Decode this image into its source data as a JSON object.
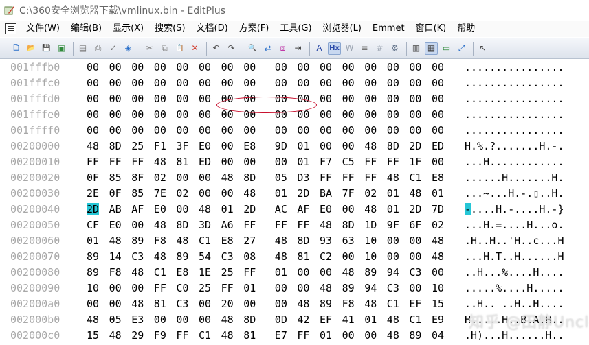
{
  "window": {
    "title": "C:\\360安全浏览器下载\\vmlinux.bin - EditPlus"
  },
  "menu": [
    "文件(W)",
    "编辑(B)",
    "显示(X)",
    "搜索(S)",
    "文档(D)",
    "方案(F)",
    "工具(G)",
    "浏览器(L)",
    "Emmet",
    "窗口(K)",
    "帮助"
  ],
  "toolbar": {
    "buttons": [
      {
        "name": "new-icon",
        "glyph": "🗋",
        "color": "#2a6fc9"
      },
      {
        "name": "open-icon",
        "glyph": "📂",
        "color": "#c99a2a"
      },
      {
        "name": "save-icon",
        "glyph": "💾",
        "color": "#3a6aa8"
      },
      {
        "name": "save-all-icon",
        "glyph": "▣",
        "color": "#2f8a3a"
      },
      {
        "sep": true
      },
      {
        "name": "print-preview-icon",
        "glyph": "▤",
        "color": "#777"
      },
      {
        "name": "print-icon",
        "glyph": "⎙",
        "color": "#777"
      },
      {
        "name": "spell-check-icon",
        "glyph": "✓",
        "color": "#6a6a6a"
      },
      {
        "name": "browser-preview-icon",
        "glyph": "◈",
        "color": "#2a6fc9"
      },
      {
        "sep": true
      },
      {
        "name": "cut-icon",
        "glyph": "✂",
        "color": "#888"
      },
      {
        "name": "copy-icon",
        "glyph": "⧉",
        "color": "#888"
      },
      {
        "name": "paste-icon",
        "glyph": "📋",
        "color": "#888"
      },
      {
        "name": "delete-icon",
        "glyph": "✕",
        "color": "#d23a2a"
      },
      {
        "sep": true
      },
      {
        "name": "undo-icon",
        "glyph": "↶",
        "color": "#555"
      },
      {
        "name": "redo-icon",
        "glyph": "↷",
        "color": "#555"
      },
      {
        "sep": true
      },
      {
        "name": "find-icon",
        "glyph": "🔍",
        "color": "#444"
      },
      {
        "name": "replace-icon",
        "glyph": "⇄",
        "color": "#2a6fc9"
      },
      {
        "name": "find-in-files-icon",
        "glyph": "⧈",
        "color": "#c03aa8"
      },
      {
        "name": "goto-icon",
        "glyph": "⇥",
        "color": "#444"
      },
      {
        "sep": true
      },
      {
        "name": "font-icon",
        "glyph": "A",
        "color": "#2a4aa8"
      },
      {
        "name": "hex-view-icon",
        "glyph": "Hx",
        "color": "#2a4aa8",
        "active": true
      },
      {
        "name": "word-wrap-icon",
        "glyph": "W",
        "color": "#9aa3b0"
      },
      {
        "name": "ruler-icon",
        "glyph": "≡",
        "color": "#777"
      },
      {
        "name": "line-numbers-icon",
        "glyph": "#",
        "color": "#9aa3b0"
      },
      {
        "name": "settings-icon",
        "glyph": "⚙",
        "color": "#6a7a90"
      },
      {
        "sep": true
      },
      {
        "name": "directory-window-icon",
        "glyph": "▥",
        "color": "#444"
      },
      {
        "name": "cliptext-window-icon",
        "glyph": "▦",
        "color": "#444",
        "active": true
      },
      {
        "name": "output-window-icon",
        "glyph": "▭",
        "color": "#2f8a3a"
      },
      {
        "name": "fullscreen-icon",
        "glyph": "⤢",
        "color": "#2a6fc9"
      },
      {
        "sep": true
      },
      {
        "name": "pointer-icon",
        "glyph": "↖",
        "color": "#444"
      }
    ]
  },
  "hex": {
    "rows": [
      {
        "addr": "001fffb0",
        "bytes": [
          "00",
          "00",
          "00",
          "00",
          "00",
          "00",
          "00",
          "00",
          "00",
          "00",
          "00",
          "00",
          "00",
          "00",
          "00",
          "00"
        ],
        "ascii": "................"
      },
      {
        "addr": "001fffc0",
        "bytes": [
          "00",
          "00",
          "00",
          "00",
          "00",
          "00",
          "00",
          "00",
          "00",
          "00",
          "00",
          "00",
          "00",
          "00",
          "00",
          "00"
        ],
        "ascii": "................"
      },
      {
        "addr": "001fffd0",
        "bytes": [
          "00",
          "00",
          "00",
          "00",
          "00",
          "00",
          "00",
          "00",
          "00",
          "00",
          "00",
          "00",
          "00",
          "00",
          "00",
          "00"
        ],
        "ascii": "................"
      },
      {
        "addr": "001fffe0",
        "bytes": [
          "00",
          "00",
          "00",
          "00",
          "00",
          "00",
          "00",
          "00",
          "00",
          "00",
          "00",
          "00",
          "00",
          "00",
          "00",
          "00"
        ],
        "ascii": "................"
      },
      {
        "addr": "001ffff0",
        "bytes": [
          "00",
          "00",
          "00",
          "00",
          "00",
          "00",
          "00",
          "00",
          "00",
          "00",
          "00",
          "00",
          "00",
          "00",
          "00",
          "00"
        ],
        "ascii": "................"
      },
      {
        "addr": "00200000",
        "bytes": [
          "48",
          "8D",
          "25",
          "F1",
          "3F",
          "E0",
          "00",
          "E8",
          "9D",
          "01",
          "00",
          "00",
          "48",
          "8D",
          "2D",
          "ED"
        ],
        "ascii": "H.%.?.......H.-."
      },
      {
        "addr": "00200010",
        "bytes": [
          "FF",
          "FF",
          "FF",
          "48",
          "81",
          "ED",
          "00",
          "00",
          "00",
          "01",
          "F7",
          "C5",
          "FF",
          "FF",
          "1F",
          "00"
        ],
        "ascii": "...H............"
      },
      {
        "addr": "00200020",
        "bytes": [
          "0F",
          "85",
          "8F",
          "02",
          "00",
          "00",
          "48",
          "8D",
          "05",
          "D3",
          "FF",
          "FF",
          "FF",
          "48",
          "C1",
          "E8"
        ],
        "ascii": "......H.......H."
      },
      {
        "addr": "00200030",
        "bytes": [
          "2E",
          "0F",
          "85",
          "7E",
          "02",
          "00",
          "00",
          "48",
          "01",
          "2D",
          "BA",
          "7F",
          "02",
          "01",
          "48",
          "01"
        ],
        "ascii": "...~...H.-.▯..H."
      },
      {
        "addr": "00200040",
        "bytes": [
          "2D",
          "AB",
          "AF",
          "E0",
          "00",
          "48",
          "01",
          "2D",
          "AC",
          "AF",
          "E0",
          "00",
          "48",
          "01",
          "2D",
          "7D"
        ],
        "ascii": "-....H.-....H.-}"
      },
      {
        "addr": "00200050",
        "bytes": [
          "CF",
          "E0",
          "00",
          "48",
          "8D",
          "3D",
          "A6",
          "FF",
          "FF",
          "FF",
          "48",
          "8D",
          "1D",
          "9F",
          "6F",
          "02"
        ],
        "ascii": "...H.=....H...o."
      },
      {
        "addr": "00200060",
        "bytes": [
          "01",
          "48",
          "89",
          "F8",
          "48",
          "C1",
          "E8",
          "27",
          "48",
          "8D",
          "93",
          "63",
          "10",
          "00",
          "00",
          "48"
        ],
        "ascii": ".H..H..'H..c...H"
      },
      {
        "addr": "00200070",
        "bytes": [
          "89",
          "14",
          "C3",
          "48",
          "89",
          "54",
          "C3",
          "08",
          "48",
          "81",
          "C2",
          "00",
          "10",
          "00",
          "00",
          "48"
        ],
        "ascii": "...H.T..H......H"
      },
      {
        "addr": "00200080",
        "bytes": [
          "89",
          "F8",
          "48",
          "C1",
          "E8",
          "1E",
          "25",
          "FF",
          "01",
          "00",
          "00",
          "48",
          "89",
          "94",
          "C3",
          "00"
        ],
        "ascii": "..H...%....H...."
      },
      {
        "addr": "00200090",
        "bytes": [
          "10",
          "00",
          "00",
          "FF",
          "C0",
          "25",
          "FF",
          "01",
          "00",
          "00",
          "48",
          "89",
          "94",
          "C3",
          "00",
          "10"
        ],
        "ascii": ".....%....H....."
      },
      {
        "addr": "002000a0",
        "bytes": [
          "00",
          "00",
          "48",
          "81",
          "C3",
          "00",
          "20",
          "00",
          "00",
          "48",
          "89",
          "F8",
          "48",
          "C1",
          "EF",
          "15"
        ],
        "ascii": "..H.. ..H..H...."
      },
      {
        "addr": "002000b0",
        "bytes": [
          "48",
          "05",
          "E3",
          "00",
          "00",
          "00",
          "48",
          "8D",
          "0D",
          "42",
          "EF",
          "41",
          "01",
          "48",
          "C1",
          "E9"
        ],
        "ascii": "H.....H..B.A.H.."
      },
      {
        "addr": "002000c0",
        "bytes": [
          "15",
          "48",
          "29",
          "F9",
          "FF",
          "C1",
          "48",
          "81",
          "E7",
          "FF",
          "01",
          "00",
          "00",
          "48",
          "89",
          "04"
        ],
        "ascii": ".H)...H......H.."
      }
    ]
  },
  "annotation": {
    "color": "#c8102e"
  },
  "watermark": {
    "text": "知乎 @田静Uncle"
  }
}
